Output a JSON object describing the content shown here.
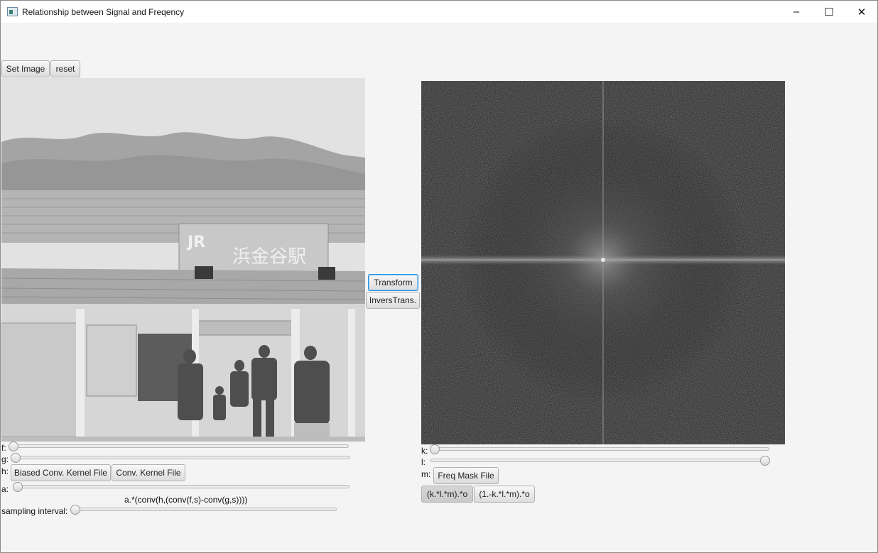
{
  "window": {
    "title": "Relationship between Signal and Freqency",
    "minimize_glyph": "–",
    "maximize_glyph": "☐",
    "close_glyph": "✕"
  },
  "toolbar": {
    "set_image_label": "Set Image",
    "reset_label": "reset"
  },
  "middle": {
    "transform_label": "Transform",
    "inverse_label": "InversTrans."
  },
  "left_controls": {
    "f_label": "f:",
    "f_value": 0.0,
    "g_label": "g:",
    "g_value": 0.0,
    "h_label": "h:",
    "biased_kernel_label": "Biased Conv. Kernel File",
    "kernel_label": "Conv. Kernel File",
    "a_label": "a:",
    "a_value": 0.0,
    "formula": "a.*(conv(h,(conv(f,s)-conv(g,s))))",
    "sampling_label": "sampling interval:",
    "sampling_value": 0.0
  },
  "right_controls": {
    "k_label": "k:",
    "k_value": 0.0,
    "l_label": "l:",
    "l_value": 1.0,
    "m_label": "m:",
    "freq_mask_label": "Freq Mask File",
    "mode_a_label": "(k.*l.*m).*o",
    "mode_b_label": "(1.-k.*l.*m).*o",
    "selected_mode": "(k.*l.*m).*o"
  },
  "images": {
    "photo": "station-photo-grayscale",
    "spectrum": "frequency-spectrum-magnitude"
  },
  "colors": {
    "focus_border": "#1e90e6",
    "panel_background": "#f4f4f4"
  }
}
